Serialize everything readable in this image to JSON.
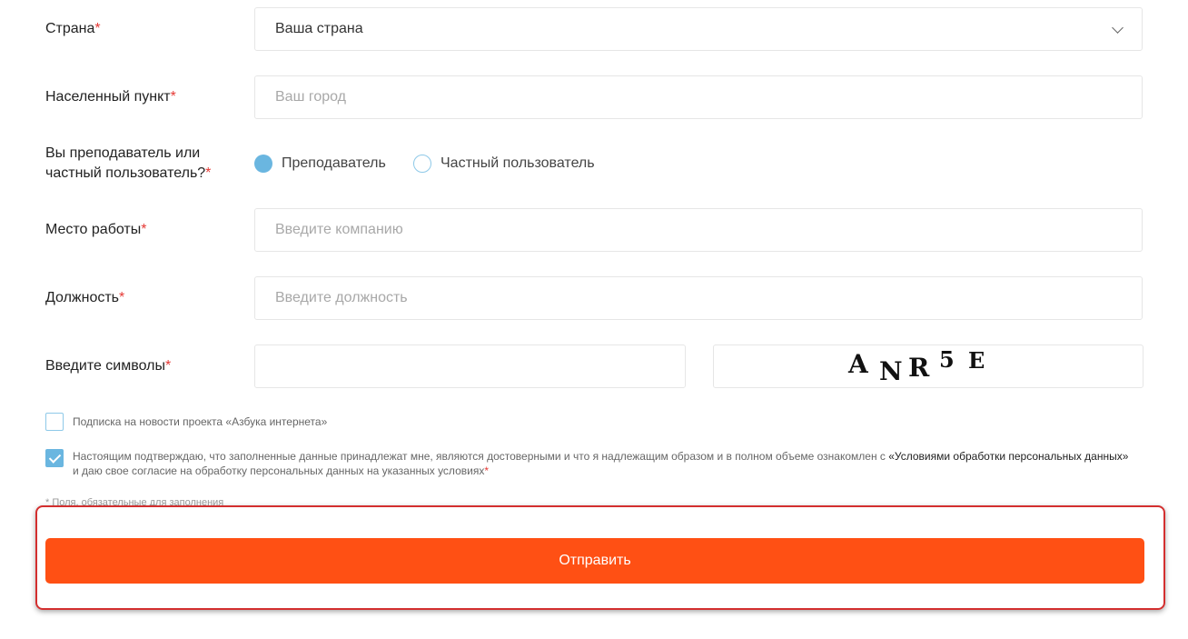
{
  "form": {
    "country": {
      "label": "Страна",
      "value": "Ваша страна"
    },
    "city": {
      "label": "Населенный пункт",
      "placeholder": "Ваш город"
    },
    "role": {
      "label_line1": "Вы преподаватель или",
      "label_line2": "частный пользователь?",
      "options": [
        {
          "label": "Преподаватель",
          "selected": true
        },
        {
          "label": "Частный пользователь",
          "selected": false
        }
      ]
    },
    "workplace": {
      "label": "Место работы",
      "placeholder": "Введите компанию"
    },
    "position": {
      "label": "Должность",
      "placeholder": "Введите должность"
    },
    "captcha": {
      "label": "Введите символы",
      "value": "",
      "chars": [
        "A",
        "N",
        "R",
        "5",
        "E"
      ]
    },
    "required_mark": "*",
    "newsletter": {
      "label": "Подписка на новости проекта «Азбука интернета»",
      "checked": false
    },
    "consent": {
      "text_before": "Настоящим подтверждаю, что заполненные данные принадлежат мне, являются достоверными и что я надлежащим образом и в полном объеме ознакомлен с ",
      "link": "«Условиями обработки персональных данных»",
      "text_after": "и даю свое согласие на обработку персональных данных на указанных условиях",
      "checked": true
    },
    "footnote": "* Поля, обязательные для заполнения",
    "submit_label": "Отправить"
  },
  "colors": {
    "accent": "#ff5014",
    "radio": "#6ab6e0",
    "required": "#e53935",
    "highlight": "#d32f2f"
  }
}
